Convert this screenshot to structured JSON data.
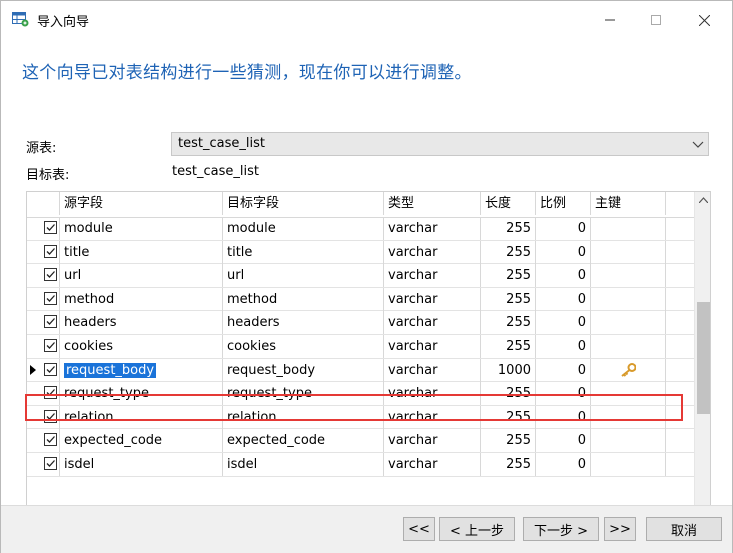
{
  "window": {
    "title": "导入向导"
  },
  "headline": "这个向导已对表结构进行一些猜测，现在你可以进行调整。",
  "source": {
    "label": "源表:",
    "value": "test_case_list"
  },
  "target": {
    "label": "目标表:",
    "value": "test_case_list"
  },
  "grid": {
    "columns": [
      "源字段",
      "目标字段",
      "类型",
      "长度",
      "比例",
      "主键"
    ],
    "rows": [
      {
        "src": "module",
        "dst": "module",
        "type": "varchar",
        "len": "255",
        "scale": "0"
      },
      {
        "src": "title",
        "dst": "title",
        "type": "varchar",
        "len": "255",
        "scale": "0"
      },
      {
        "src": "url",
        "dst": "url",
        "type": "varchar",
        "len": "255",
        "scale": "0"
      },
      {
        "src": "method",
        "dst": "method",
        "type": "varchar",
        "len": "255",
        "scale": "0"
      },
      {
        "src": "headers",
        "dst": "headers",
        "type": "varchar",
        "len": "255",
        "scale": "0"
      },
      {
        "src": "cookies",
        "dst": "cookies",
        "type": "varchar",
        "len": "255",
        "scale": "0"
      },
      {
        "src": "request_body",
        "dst": "request_body",
        "type": "varchar",
        "len": "1000",
        "scale": "0",
        "selected": true,
        "primary_key": true
      },
      {
        "src": "request_type",
        "dst": "request_type",
        "type": "varchar",
        "len": "255",
        "scale": "0"
      },
      {
        "src": "relation",
        "dst": "relation",
        "type": "varchar",
        "len": "255",
        "scale": "0"
      },
      {
        "src": "expected_code",
        "dst": "expected_code",
        "type": "varchar",
        "len": "255",
        "scale": "0"
      },
      {
        "src": "isdel",
        "dst": "isdel",
        "type": "varchar",
        "len": "255",
        "scale": "0"
      }
    ]
  },
  "footer": {
    "first_label": "<<",
    "prev_label": "< 上一步",
    "next_label": "下一步 >",
    "last_label": ">>",
    "cancel_label": "取消"
  },
  "colors": {
    "headline": "#1e63b5",
    "selection": "#1a73d9",
    "highlight": "#e53935",
    "key": "#d89a2b"
  }
}
